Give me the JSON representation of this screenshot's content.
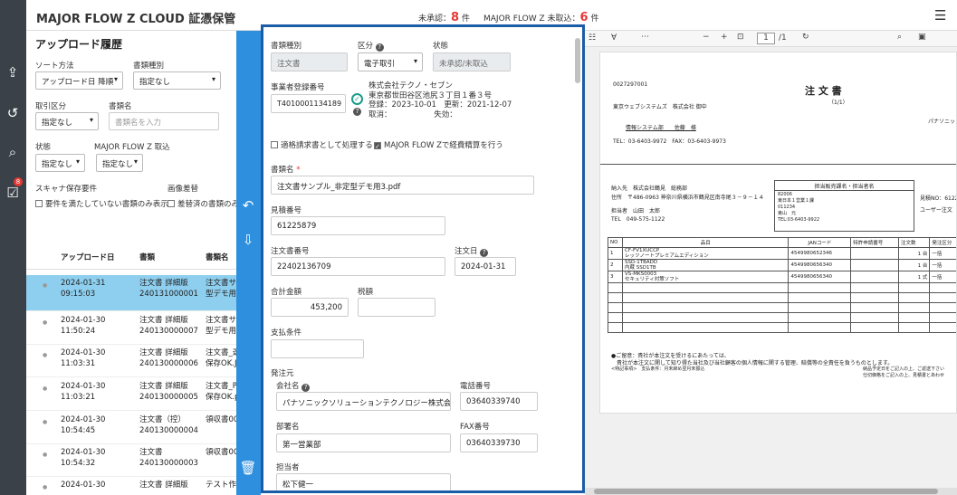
{
  "app": {
    "title": "MAJOR FLOW Z CLOUD 証憑保管",
    "unapproved_label": "未承認：",
    "unapproved_count": "8",
    "unapproved_unit": "件",
    "unimported_label": "MAJOR FLOW Z 未取込：",
    "unimported_count": "6",
    "unimported_unit": "件"
  },
  "nav": {
    "badge": "8"
  },
  "upload": {
    "title": "アップロード履歴",
    "sort_label": "ソート方法",
    "sort_value": "アップロード日 降順",
    "doctype_label": "書類種別",
    "doctype_value": "指定なし",
    "trade_label": "取引区分",
    "trade_value": "指定なし",
    "docname_label": "書類名",
    "docname_placeholder": "書類名を入力",
    "state_label": "状態",
    "state_value": "指定なし",
    "mfz_label": "MAJOR FLOW Z 取込",
    "mfz_value": "指定なし",
    "scanner_label": "スキャナ保存要件",
    "image_label": "画像差替",
    "chk1": "要件を満たしていない書類のみ表示",
    "chk2": "差替済の書類のみ",
    "col_date": "アップロード日",
    "col_type": "書類",
    "col_name": "書類名",
    "rows": [
      {
        "date": "2024-01-31",
        "time": "09:15:03",
        "type": "注文書 詳細版",
        "no": "240131000001",
        "name1": "注文書サ",
        "name2": "型デモ用"
      },
      {
        "date": "2024-01-30",
        "time": "11:50:24",
        "type": "注文書 詳細版",
        "no": "240130000007",
        "name1": "注文書サ",
        "name2": "型デモ用"
      },
      {
        "date": "2024-01-30",
        "time": "11:03:31",
        "type": "注文書 詳細版",
        "no": "240130000006",
        "name1": "注文書_選",
        "name2": "保存OK.J"
      },
      {
        "date": "2024-01-30",
        "time": "11:03:21",
        "type": "注文書 詳細版",
        "no": "240130000005",
        "name1": "注文書_P",
        "name2": "保存OK.p"
      },
      {
        "date": "2024-01-30",
        "time": "10:54:45",
        "type": "注文書（控）",
        "no": "240130000004",
        "name1": "領収書00",
        "name2": ""
      },
      {
        "date": "2024-01-30",
        "time": "10:54:32",
        "type": "注文書",
        "no": "240130000003",
        "name1": "領収書00",
        "name2": ""
      },
      {
        "date": "2024-01-30",
        "time": "",
        "type": "注文書 詳細版",
        "no": "",
        "name1": "テスト作",
        "name2": ""
      }
    ]
  },
  "form": {
    "doctype_label": "書類種別",
    "doctype_value": "注文書",
    "kubun_label": "区分",
    "kubun_value": "電子取引",
    "state_label": "状態",
    "state_value": "未承認/未取込",
    "regno_label": "事業者登録番号",
    "regno_value": "T4010001134189",
    "company": "株式会社テクノ・セブン",
    "address": "東京都世田谷区池尻３丁目１番３号",
    "reg_line": "登録：2023-10-01　更新：2021-12-07",
    "cancel_line": "取消：　　　　　　失効：",
    "chk_invoice": "適格請求書として処理する",
    "chk_expense": "MAJOR FLOW Zで経費精算を行う",
    "docname_label": "書類名",
    "docname_value": "注文書サンプル_非定型デモ用3.pdf",
    "estimate_label": "見積番号",
    "estimate_value": "61225879",
    "order_label": "注文書番号",
    "order_value": "22402136709",
    "orderdate_label": "注文日",
    "orderdate_value": "2024-01-31",
    "total_label": "合計金額",
    "total_value": "453,200",
    "tax_label": "税額",
    "tax_value": "",
    "pay_label": "支払条件",
    "pay_value": "",
    "issuer_label": "発注元",
    "company_label": "会社名",
    "company_value": "パナソニックソリューションテクノロジー株式会社",
    "tel_label": "電話番号",
    "tel_value": "03640339740",
    "dept_label": "部署名",
    "dept_value": "第一営業部",
    "fax_label": "FAX番号",
    "fax_value": "03640339730",
    "person_label": "担当者",
    "person_value": "松下健一"
  },
  "pdf": {
    "page": "1",
    "pages": "/1",
    "code": "0027297001",
    "title": "注 文 書",
    "pagecount": "（1/1）",
    "to": "東京ウェブシステムズ　株式会社 御中",
    "right1": "パナソニッ",
    "dept": "情報システム部　　佐藤　様",
    "contact": "TEL：03-6403-9972　FAX：03-6403-9973",
    "ship_to": "納入先　株式会社鶴見　総務部",
    "addr": "住所　〒486-0963 神奈川県横浜市鶴見区南寺尾３－９－１４",
    "staff": "担当者　山田　太郎",
    "tel": "TEL　049-575-1122",
    "sales_head": "担当販売課名・担当者名",
    "sales_lines": [
      "82006",
      "東日本１営業１課",
      "011234",
      "東山　元",
      "TEL:03-6403-9922"
    ],
    "est_no": "見積NO：6122",
    "user": "ユーザー注文",
    "cols": [
      "NO",
      "品目",
      "JANコード",
      "特許申請番号",
      "注文数",
      "発注区分"
    ],
    "items": [
      {
        "no": "1",
        "name1": "CF-FV1XUCCP",
        "name2": "レッツノートプレミアムエディション",
        "jan": "4549980652346",
        "qty": "1 台",
        "kind": "一括"
      },
      {
        "no": "2",
        "name1": "SSD-1TBADD",
        "name2": "内蔵 SSD1TB",
        "jan": "4549980656340",
        "qty": "1 台",
        "kind": "一括"
      },
      {
        "no": "3",
        "name1": "VS-MKS0003",
        "name2": "セキュリティ対策ソフト",
        "jan": "4549980656340",
        "qty": "1 式",
        "kind": "一括"
      }
    ],
    "note1": "●ご留意：貴社が本注文を受けるにあたっては、",
    "note2": "貴社が本注文に関して知り得た当社及び当社顧客の個人情報に関する管理、賠償等の全責任を負うものとします。",
    "note3": "<特記事項>　支払条件：月末締め翌月末振込",
    "note4": "納品予定日をご記入の上、ご返送下さい",
    "note5": "仕切価格をご記入の上、見積書とあわせ"
  }
}
